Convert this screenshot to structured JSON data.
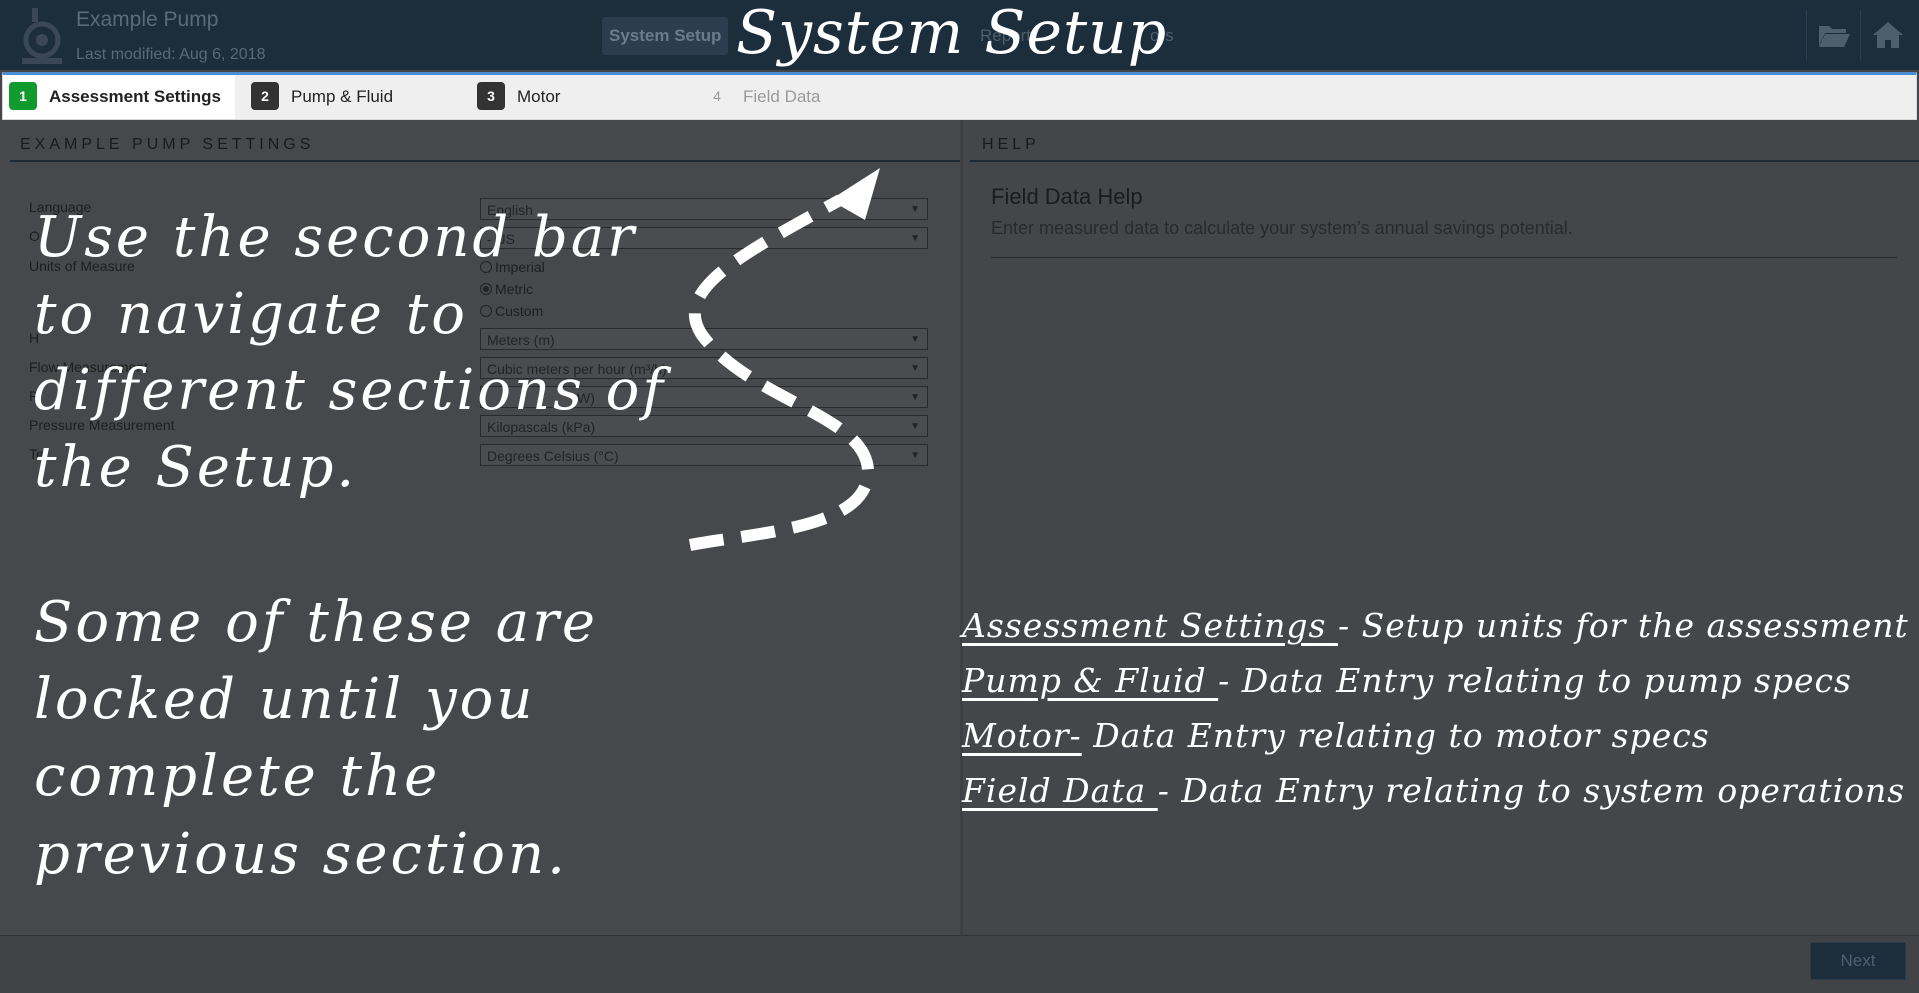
{
  "header": {
    "app_title": "Example Pump",
    "last_modified": "Last modified: Aug 6, 2018",
    "tabs": [
      {
        "label": "System Setup"
      },
      {
        "label": "Report"
      },
      {
        "label": "ors"
      }
    ],
    "icons": [
      "folder-icon",
      "home-icon"
    ],
    "brand_color": "#1c2d3c"
  },
  "overlay": {
    "title": "System Setup",
    "note_top": [
      "Use the second bar",
      "to navigate to",
      "different sections of",
      "the Setup."
    ],
    "note_bottom": [
      "Some of these are",
      "locked until you",
      "complete the",
      "previous section."
    ],
    "legend": [
      {
        "term": "Assessment Settings ",
        "desc": " - Setup units for the assessment"
      },
      {
        "term": "Pump & Fluid ",
        "desc": " - Data Entry relating to pump specs"
      },
      {
        "term": "Motor-",
        "desc": " Data Entry relating to motor specs"
      },
      {
        "term": "Field Data ",
        "desc": " - Data Entry relating to system operations"
      }
    ]
  },
  "steps": [
    {
      "num": "1",
      "label": "Assessment Settings",
      "state": "active"
    },
    {
      "num": "2",
      "label": "Pump & Fluid",
      "state": "available"
    },
    {
      "num": "3",
      "label": "Motor",
      "state": "available"
    },
    {
      "num": "4",
      "label": "Field Data",
      "state": "locked"
    }
  ],
  "left_panel": {
    "heading": "EXAMPLE PUMP SETTINGS",
    "fields": {
      "language": {
        "label": "Language",
        "value": "English"
      },
      "other": {
        "label": "O",
        "value": "- US"
      },
      "units": {
        "label": "Units of Measure",
        "options": [
          "Imperial",
          "Metric",
          "Custom"
        ],
        "selected": "Metric"
      },
      "head": {
        "label": "H",
        "value": "Meters (m)"
      },
      "flow": {
        "label": "Flow Measurement",
        "value": "Cubic meters per hour (m³/h)"
      },
      "power": {
        "label": "P",
        "value": "W)"
      },
      "pressure": {
        "label": "Pressure Measurement",
        "value": "Kilopascals (kPa)"
      },
      "temperature": {
        "label": "Te",
        "value": "Degrees Celsius (°C)"
      }
    }
  },
  "right_panel": {
    "heading": "HELP",
    "help_title": "Field Data Help",
    "help_text": "Enter measured data to calculate your system's annual savings potential."
  },
  "footer": {
    "next_label": "Next"
  },
  "colors": {
    "active_step": "#129a2f",
    "overlay_text": "#ffffff",
    "dim_background": "#444649"
  }
}
